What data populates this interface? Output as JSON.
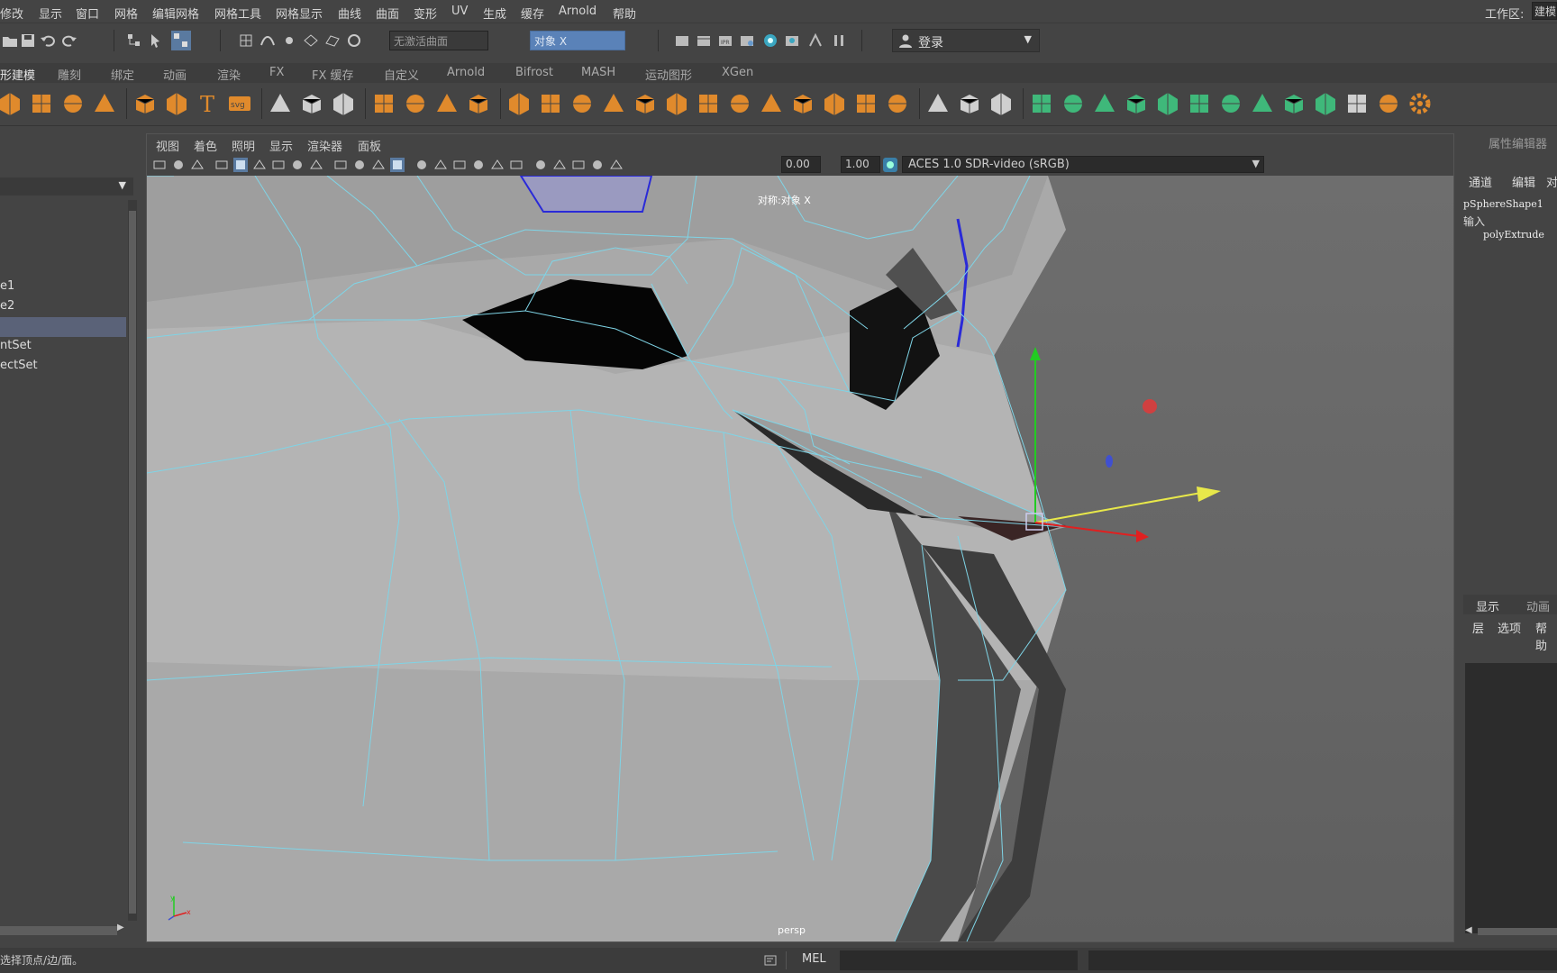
{
  "menubar": {
    "items": [
      "修改",
      "显示",
      "窗口",
      "网格",
      "编辑网格",
      "网格工具",
      "网格显示",
      "曲线",
      "曲面",
      "变形",
      "UV",
      "生成",
      "缓存",
      "Arnold",
      "帮助"
    ],
    "workspace_label": "工作区:",
    "workspace_value": "建模"
  },
  "toolbar": {
    "live_surface": "无激活曲面",
    "symmetry": "对象 X",
    "login": "登录"
  },
  "shelf_tabs": [
    "形建模",
    "雕刻",
    "绑定",
    "动画",
    "渲染",
    "FX",
    "FX 缓存",
    "自定义",
    "Arnold",
    "Bifrost",
    "MASH",
    "运动图形",
    "XGen"
  ],
  "shelf_icons": [
    "poly-sphere-icon",
    "poly-cube-icon",
    "cylinder-icon",
    "torus-icon",
    "soccer-ball-icon",
    "star-icon",
    "text-icon",
    "svg-icon",
    "measure-icon",
    "snap-icon",
    "zero-icon",
    "mirror-icon",
    "combine-icon",
    "separate-icon",
    "grid-icon",
    "smooth-icon",
    "rotate-icon",
    "bevel-icon",
    "extrude-icon",
    "bridge-icon",
    "merge-icon",
    "cube-icon",
    "cut-icon",
    "sphere-grid-icon",
    "boolean-icon",
    "plane-icon",
    "mesh-icon",
    "multicut-icon",
    "pencil-icon",
    "frame-icon",
    "brush-icon",
    "green-box-icon",
    "green-cylinder-icon",
    "green-half-icon",
    "green-cubes-icon",
    "green-arrow-icon",
    "green-grid-icon",
    "cross-icon",
    "scissors-icon",
    "pipe-icon",
    "split-icon",
    "axis-icon",
    "orange-cube-icon",
    "settings-gear-icon"
  ],
  "outliner": {
    "items": [
      "e1",
      "e2",
      "",
      "ntSet",
      "ectSet"
    ]
  },
  "viewport": {
    "menu": [
      "视图",
      "着色",
      "照明",
      "显示",
      "渲染器",
      "面板"
    ],
    "field_a": "0.00",
    "field_b": "1.00",
    "colorspace": "ACES 1.0 SDR-video (sRGB)",
    "symmetry_label": "对称:对象 X",
    "camera_label": "persp",
    "axis_x": "x",
    "axis_y": "y"
  },
  "attribute_editor": {
    "title": "属性编辑器",
    "tabs": [
      "通道",
      "编辑",
      "对"
    ],
    "shape": "pSphereShape1",
    "inputs_label": "输入",
    "input_node": "polyExtrude"
  },
  "layer_editor": {
    "tabs": [
      "显示",
      "动画"
    ],
    "menu": [
      "层",
      "选项",
      "帮助"
    ]
  },
  "status": {
    "help_text": "选择顶点/边/面。",
    "mel_label": "MEL"
  },
  "colors": {
    "wire": "#7fd4e6",
    "select_blue": "#2a2ad8",
    "shelf_orange": "#e08a2c",
    "shelf_green": "#3fb87a"
  }
}
